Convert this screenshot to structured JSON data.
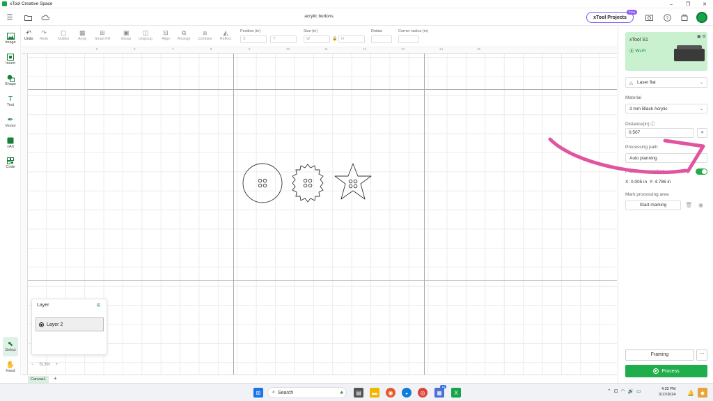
{
  "window": {
    "title": "xTool Creative Space"
  },
  "topbar": {
    "doc_title": "acrylic buttons",
    "projects_label": "xTool Projects",
    "free_badge": "Free"
  },
  "left_tools": [
    {
      "label": "Image",
      "icon": "image-icon"
    },
    {
      "label": "Insert",
      "icon": "insert-icon"
    },
    {
      "label": "Shape",
      "icon": "shape-icon"
    },
    {
      "label": "Text",
      "icon": "text-icon"
    },
    {
      "label": "Vector",
      "icon": "pen-icon"
    },
    {
      "label": "xArt",
      "icon": "xart-icon"
    },
    {
      "label": "Code",
      "icon": "qr-code-icon"
    },
    {
      "label": "Select",
      "icon": "cursor-icon"
    },
    {
      "label": "Hand",
      "icon": "hand-icon"
    }
  ],
  "edit_tools": [
    "Undo",
    "Redo",
    "Outline",
    "Array",
    "Smart Fill",
    "Group",
    "Ungroup",
    "Align",
    "Arrange",
    "Combine",
    "Reflect"
  ],
  "fields": {
    "position_label": "Position (in)",
    "x_placeholder": "X",
    "y_placeholder": "Y",
    "size_label": "Size (in)",
    "w_placeholder": "W",
    "h_placeholder": "H",
    "rotate_label": "Rotate",
    "corner_label": "Corner radius (in)"
  },
  "ruler_ticks": [
    "5",
    "6",
    "7",
    "8",
    "9",
    "10",
    "11",
    "12",
    "13",
    "14",
    "15"
  ],
  "layer_panel": {
    "title": "Layer",
    "items": [
      "Layer 2"
    ]
  },
  "zoom": {
    "minus": "−",
    "value": "513%",
    "plus": "+"
  },
  "canvas_tabs": [
    "Canvas1"
  ],
  "right_panel": {
    "device_name": "xTool S1",
    "device_connection": "Wi-Fi",
    "mode": "Laser flat",
    "material_label": "Material",
    "material_value": "3 mm Black Acrylic",
    "distance_label": "Distance(in)",
    "distance_value": "0.507",
    "processing_path_label": "Processing path",
    "processing_path_value": "Auto planning",
    "position_toggle_label": "Processing position",
    "coord_x": "X: 0.005 in",
    "coord_y": "Y: 4.786 in",
    "mark_area_label": "Mark processing area",
    "start_marking": "Start marking",
    "framing": "Framing",
    "more": "···",
    "process": "Process"
  },
  "taskbar": {
    "search": "Search",
    "time": "4:32 PM",
    "date": "3/17/2024",
    "badge": "18"
  },
  "colors": {
    "accent": "#1fae4b",
    "arrow": "#e0559f",
    "projects_border": "#7c4dff"
  }
}
